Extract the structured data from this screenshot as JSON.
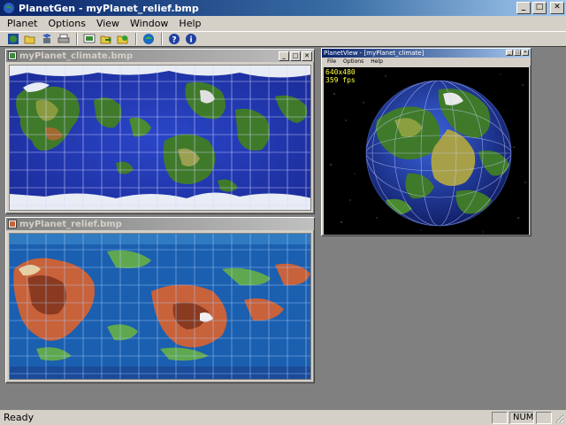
{
  "window": {
    "title": "PlanetGen - myPlanet_relief.bmp",
    "minimize": "_",
    "maximize": "□",
    "close": "✕"
  },
  "menu": [
    "Planet",
    "Options",
    "View",
    "Window",
    "Help"
  ],
  "toolbar": {
    "groups": [
      [
        "globe-icon",
        "open-folder-icon",
        "save-icon",
        "print-icon"
      ],
      [
        "planet-view-icon",
        "export-icon",
        "folder-gear-icon"
      ],
      [
        "sphere-icon"
      ],
      [
        "help-icon",
        "about-icon"
      ]
    ]
  },
  "windows": {
    "climate": {
      "title": "myPlanet_climate.bmp"
    },
    "relief": {
      "title": "myPlanet_relief.bmp"
    },
    "planetview": {
      "title": "PlanetView - [myPlanet_climate]",
      "menu": [
        "File",
        "Options",
        "Help"
      ],
      "resolution": "640x480",
      "fps": "359 fps"
    }
  },
  "status": {
    "text": "Ready",
    "num": "NUM"
  },
  "colors": {
    "ocean": "#1f38b8",
    "land_green": "#3f7a2a",
    "relief_ocean": "#1b5fb0",
    "relief_land": "#c8623a",
    "space": "#000000"
  }
}
